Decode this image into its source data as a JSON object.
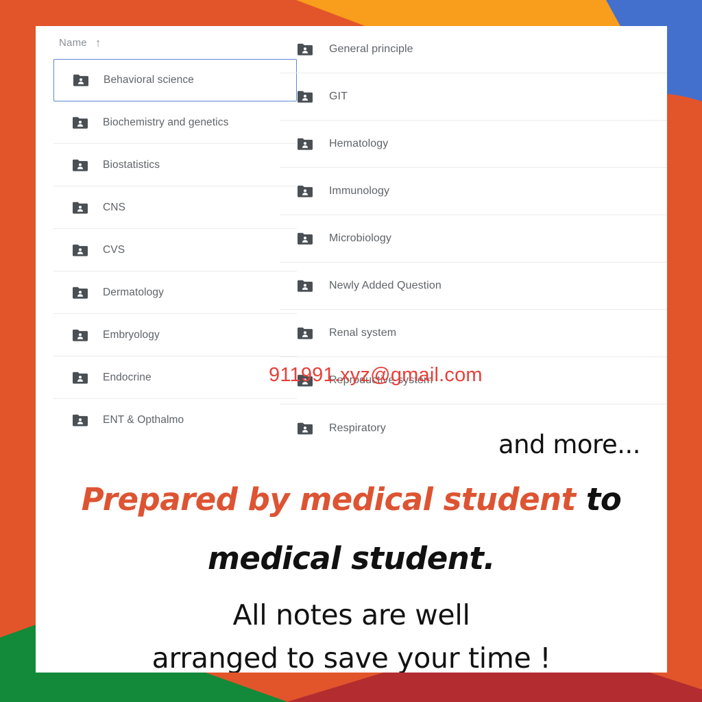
{
  "theme": {
    "band_red": "#e2552b",
    "band_orange": "#f99d1c",
    "band_blue": "#4470cd",
    "band_green": "#128a3a",
    "band_darkred": "#b22c30",
    "card_bg": "#ffffff",
    "selection_border": "#5b87d4",
    "row_divider": "#ececec",
    "label_color": "#5f6368",
    "accent_text": "#dd5433",
    "watermark_color": "#e8403a"
  },
  "browser": {
    "left_column": {
      "header": {
        "label": "Name",
        "sort_icon": "arrow-up-icon",
        "sort_glyph": "↑"
      },
      "rows": [
        {
          "label": "Behavioral science",
          "icon": "shared-folder-icon",
          "selected": true
        },
        {
          "label": "Biochemistry and genetics",
          "icon": "shared-folder-icon",
          "selected": false
        },
        {
          "label": "Biostatistics",
          "icon": "shared-folder-icon",
          "selected": false
        },
        {
          "label": "CNS",
          "icon": "shared-folder-icon",
          "selected": false
        },
        {
          "label": "CVS",
          "icon": "shared-folder-icon",
          "selected": false
        },
        {
          "label": "Dermatology",
          "icon": "shared-folder-icon",
          "selected": false
        },
        {
          "label": "Embryology",
          "icon": "shared-folder-icon",
          "selected": false
        },
        {
          "label": "Endocrine",
          "icon": "shared-folder-icon",
          "selected": false
        },
        {
          "label": "ENT & Opthalmo",
          "icon": "shared-folder-icon",
          "selected": false
        }
      ]
    },
    "right_column": {
      "rows": [
        {
          "label": "General principle",
          "icon": "shared-folder-icon"
        },
        {
          "label": "GIT",
          "icon": "shared-folder-icon"
        },
        {
          "label": "Hematology",
          "icon": "shared-folder-icon"
        },
        {
          "label": "Immunology",
          "icon": "shared-folder-icon"
        },
        {
          "label": "Microbiology",
          "icon": "shared-folder-icon"
        },
        {
          "label": "Newly Added Question",
          "icon": "shared-folder-icon"
        },
        {
          "label": "Renal system",
          "icon": "shared-folder-icon"
        },
        {
          "label": "Reproductive system",
          "icon": "shared-folder-icon"
        },
        {
          "label": "Respiratory",
          "icon": "shared-folder-icon"
        }
      ]
    }
  },
  "overlays": {
    "and_more": "and more...",
    "watermark_email": "911991.xyz@gmail.com",
    "tagline_line1_highlight": "Prepared by medical student",
    "tagline_line1_tail": " to",
    "tagline_line2": "medical student.",
    "closing_line1": "All notes are well",
    "closing_line2": "arranged to save your time !"
  }
}
